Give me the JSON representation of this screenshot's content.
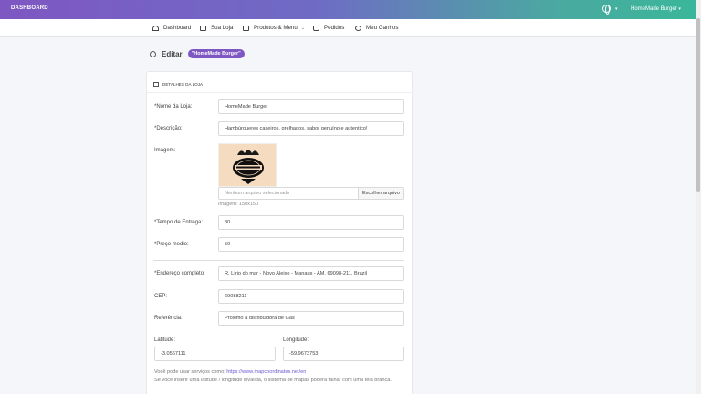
{
  "topbar": {
    "brand": "DASHBOARD",
    "user_name": "HomeMade Burger",
    "globe_icon": "globe-icon",
    "gradient": [
      "#7e57c2",
      "#3ab79a"
    ]
  },
  "nav": {
    "items": [
      {
        "label": "Dashboard",
        "icon": "speedometer-icon"
      },
      {
        "label": "Sua Loja",
        "icon": "store-icon"
      },
      {
        "label": "Produtos & Menu",
        "icon": "menu-book-icon"
      },
      {
        "label": "Pedidos",
        "icon": "basket-icon"
      },
      {
        "label": "Meu Ganhos",
        "icon": "coins-icon"
      }
    ]
  },
  "page": {
    "title": "Editar",
    "badge": "\"HomeMade Burger\"",
    "accent": "#7e57c2"
  },
  "card": {
    "heading": "DETALHES DA LOJA",
    "fields": {
      "name_label": "*Nome da Loja:",
      "name_value": "HomeMade Burger",
      "desc_label": "*Descrição:",
      "desc_value": "Hambúrgueres caseiros, grelhados, sabor genuíno e autentico!",
      "image_label": "Imagem:",
      "file_placeholder": "Nenhum arquivo selecionado",
      "file_button": "Escolher arquivo",
      "image_hint": "Imagem: 150x150",
      "delivery_label": "*Tempo de Entrega:",
      "delivery_value": "30",
      "price_label": "*Preço medio:",
      "price_value": "50",
      "address_label": "*Endereço completo:",
      "address_value": "R. Lírio do mar - Novo Aleixo - Manaus - AM, 69098-211, Brazil",
      "cep_label": "CEP:",
      "cep_value": "69088211",
      "ref_label": "Referência:",
      "ref_value": "Próximo a distribuidora de Gás",
      "lat_label": "Latitude:",
      "lat_value": "-3.0567111",
      "lng_label": "Longitude:",
      "lng_value": "-59.9673753"
    },
    "note_line1_prefix": "Você pode usar serviços como: ",
    "note_link": "https://www.mapcoordinates.net/en",
    "note_line2": "Se você inserir uma latitude / longitude inválida, o sistema de mapas poderá falhar com uma tela branca."
  }
}
